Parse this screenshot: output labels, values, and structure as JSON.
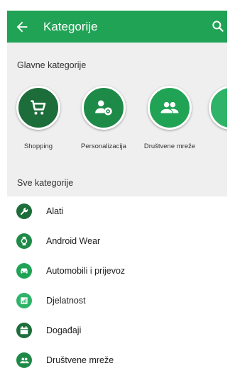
{
  "colors": {
    "appbar": "#21a356",
    "dark_green": "#1c6d3a",
    "mid_green": "#1e8a47",
    "light_green": "#2fb369"
  },
  "header": {
    "title": "Kategorije",
    "back_icon": "arrow-left-icon",
    "search_icon": "search-icon"
  },
  "featured": {
    "heading": "Glavne kategorije",
    "items": [
      {
        "label": "Shopping",
        "icon": "shopping-cart-icon",
        "color": "#1c6d3a"
      },
      {
        "label": "Personalizacija",
        "icon": "person-gear-icon",
        "color": "#1e8a47"
      },
      {
        "label": "Društvene mreže",
        "icon": "people-icon",
        "color": "#21a356"
      }
    ]
  },
  "all": {
    "heading": "Sve kategorije",
    "items": [
      {
        "label": "Alati",
        "icon": "wrench-icon",
        "color": "#1c6d3a"
      },
      {
        "label": "Android Wear",
        "icon": "watch-icon",
        "color": "#1e8a47"
      },
      {
        "label": "Automobili i prijevoz",
        "icon": "car-icon",
        "color": "#21a356"
      },
      {
        "label": "Djelatnost",
        "icon": "chart-icon",
        "color": "#2fb369"
      },
      {
        "label": "Događaji",
        "icon": "calendar-icon",
        "color": "#1c6d3a"
      },
      {
        "label": "Društvene mreže",
        "icon": "people-icon",
        "color": "#1e8a47"
      }
    ]
  }
}
